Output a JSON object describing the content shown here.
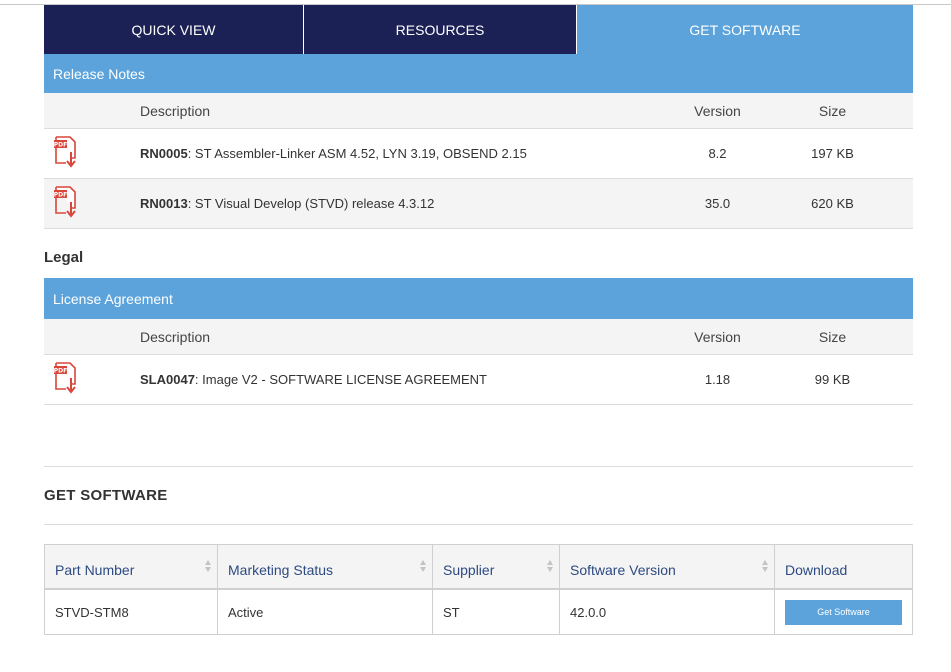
{
  "tabs": [
    {
      "label": "QUICK VIEW"
    },
    {
      "label": "RESOURCES"
    },
    {
      "label": "GET SOFTWARE",
      "active": true
    }
  ],
  "release_notes": {
    "title": "Release Notes",
    "headers": {
      "description": "Description",
      "version": "Version",
      "size": "Size"
    },
    "rows": [
      {
        "icon": "pdf-download-icon",
        "code": "RN0005",
        "text": ": ST Assembler-Linker ASM 4.52, LYN 3.19, OBSEND 2.15",
        "version": "8.2",
        "size": "197 KB"
      },
      {
        "icon": "pdf-download-icon",
        "code": "RN0013",
        "text": ": ST Visual Develop (STVD) release 4.3.12",
        "version": "35.0",
        "size": "620 KB"
      }
    ]
  },
  "legal": {
    "heading": "Legal",
    "title": "License Agreement",
    "headers": {
      "description": "Description",
      "version": "Version",
      "size": "Size"
    },
    "rows": [
      {
        "icon": "pdf-download-icon",
        "code": "SLA0047",
        "text": ": Image V2 - SOFTWARE LICENSE AGREEMENT",
        "version": "1.18",
        "size": "99 KB"
      }
    ]
  },
  "get_software": {
    "title": "GET SOFTWARE",
    "headers": [
      "Part Number",
      "Marketing Status",
      "Supplier",
      "Software Version",
      "Download"
    ],
    "rows": [
      {
        "part_number": "STVD-STM8",
        "status": "Active",
        "supplier": "ST",
        "version": "42.0.0",
        "button": "Get Software"
      }
    ]
  },
  "colors": {
    "navy": "#1b2155",
    "accent": "#5ca3db",
    "pdf_red": "#d9463a"
  }
}
